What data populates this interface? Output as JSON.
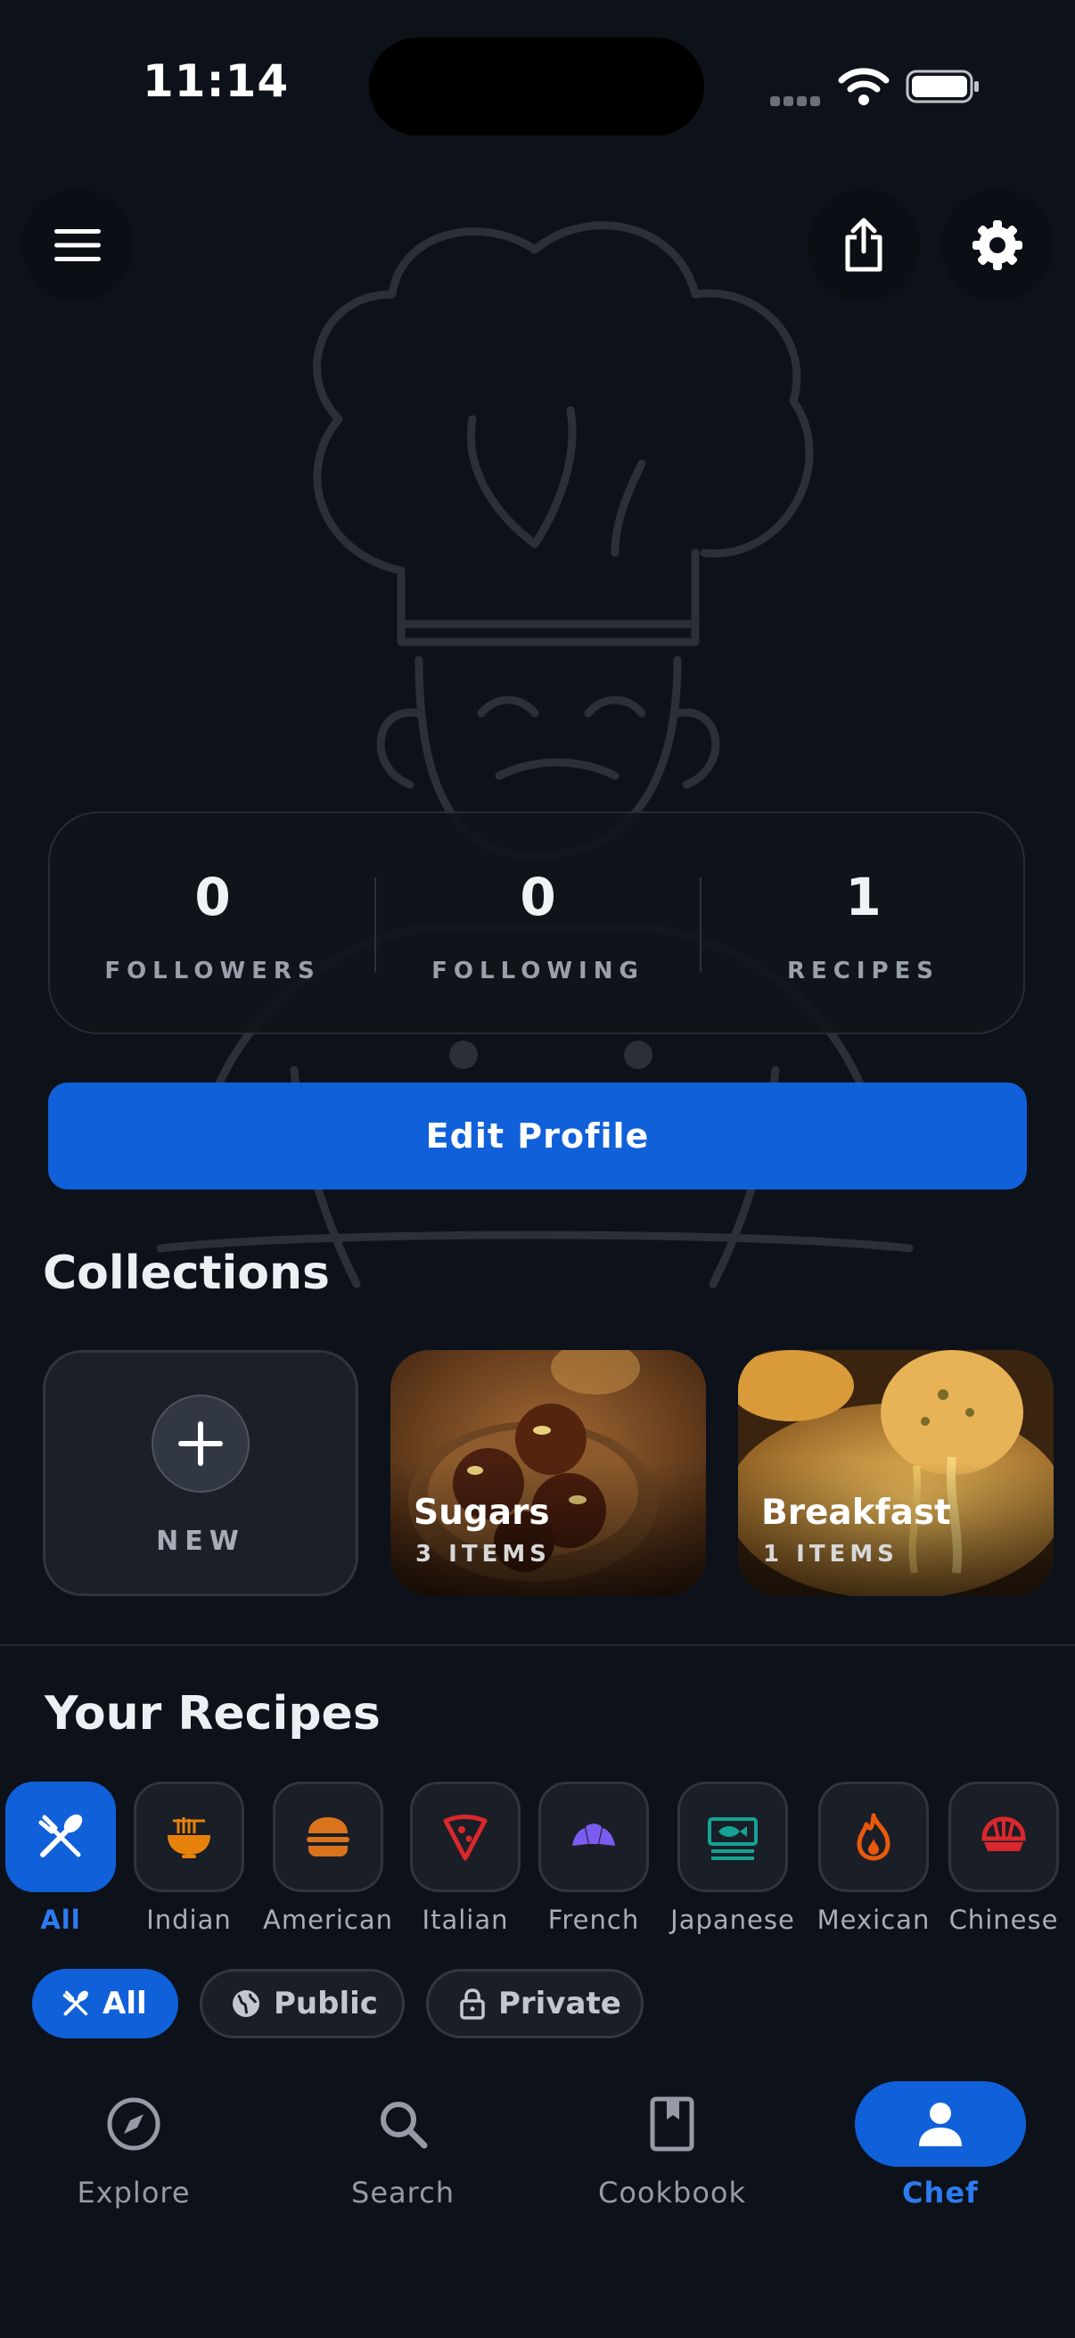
{
  "status_bar": {
    "time": "11:14"
  },
  "stats": [
    {
      "value": "0",
      "label": "FOLLOWERS"
    },
    {
      "value": "0",
      "label": "FOLLOWING"
    },
    {
      "value": "1",
      "label": "RECIPES"
    }
  ],
  "edit_profile_label": "Edit Profile",
  "collections": {
    "title": "Collections",
    "new_label": "NEW",
    "items": [
      {
        "name": "Sugars",
        "count": "3 ITEMS"
      },
      {
        "name": "Breakfast",
        "count": "1 ITEMS"
      }
    ]
  },
  "recipes": {
    "title": "Your Recipes",
    "categories": [
      {
        "label": "All",
        "icon": "utensils-icon",
        "color": "#ffffff"
      },
      {
        "label": "Indian",
        "icon": "noodle-bowl-icon",
        "color": "#e8820c"
      },
      {
        "label": "American",
        "icon": "burger-icon",
        "color": "#d9731c"
      },
      {
        "label": "Italian",
        "icon": "pizza-slice-icon",
        "color": "#d8282c"
      },
      {
        "label": "French",
        "icon": "croissant-icon",
        "color": "#7c5cf0"
      },
      {
        "label": "Japanese",
        "icon": "fish-icon",
        "color": "#14a394"
      },
      {
        "label": "Mexican",
        "icon": "flame-icon",
        "color": "#e8590c"
      },
      {
        "label": "Chinese",
        "icon": "bao-icon",
        "color": "#d8282c"
      }
    ],
    "filters": [
      {
        "label": "All",
        "icon": "utensils-icon"
      },
      {
        "label": "Public",
        "icon": "globe-icon"
      },
      {
        "label": "Private",
        "icon": "lock-icon"
      }
    ]
  },
  "tabs": [
    {
      "label": "Explore",
      "icon": "compass-icon"
    },
    {
      "label": "Search",
      "icon": "search-icon"
    },
    {
      "label": "Cookbook",
      "icon": "book-icon"
    },
    {
      "label": "Chef",
      "icon": "person-icon"
    }
  ],
  "colors": {
    "accent": "#1060d9",
    "background": "#0d1119",
    "card": "#1a1e27"
  }
}
